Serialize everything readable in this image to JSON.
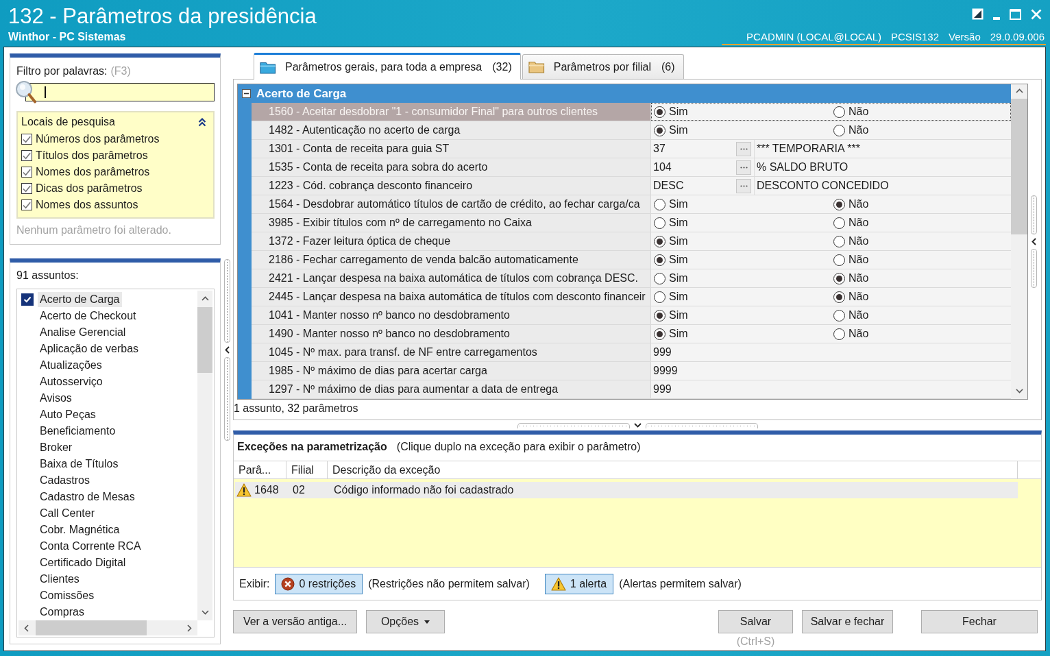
{
  "window": {
    "title": "132 - Parâmetros da presidência",
    "subtitle": "Winthor - PC Sistemas",
    "session": "PCADMIN (LOCAL@LOCAL)",
    "program": "PCSIS132",
    "version_label": "Versão",
    "version": "29.0.09.006"
  },
  "filter": {
    "label": "Filtro por palavras:",
    "shortcut": "(F3)"
  },
  "search_locations": {
    "title": "Locais de pesquisa",
    "expanded": true,
    "options": [
      {
        "label": "Números dos parâmetros",
        "checked": true
      },
      {
        "label": "Títulos dos parâmetros",
        "checked": true
      },
      {
        "label": "Nomes dos parâmetros",
        "checked": true
      },
      {
        "label": "Dicas dos parâmetros",
        "checked": true
      },
      {
        "label": "Nomes dos assuntos",
        "checked": true
      }
    ]
  },
  "change_status": "Nenhum parâmetro foi alterado.",
  "subjects": {
    "count_label": "91 assuntos:",
    "items": [
      {
        "label": "Acerto de Carga",
        "checked": true,
        "selected": true
      },
      {
        "label": "Acerto de Checkout",
        "checked": false,
        "selected": false
      },
      {
        "label": "Analise Gerencial",
        "checked": false,
        "selected": false
      },
      {
        "label": "Aplicação de verbas",
        "checked": false,
        "selected": false
      },
      {
        "label": "Atualizações",
        "checked": false,
        "selected": false
      },
      {
        "label": "Autosserviço",
        "checked": false,
        "selected": false
      },
      {
        "label": "Avisos",
        "checked": false,
        "selected": false
      },
      {
        "label": "Auto Peças",
        "checked": false,
        "selected": false
      },
      {
        "label": "Beneficiamento",
        "checked": false,
        "selected": false
      },
      {
        "label": "Broker",
        "checked": false,
        "selected": false
      },
      {
        "label": "Baixa de Títulos",
        "checked": false,
        "selected": false
      },
      {
        "label": "Cadastros",
        "checked": false,
        "selected": false
      },
      {
        "label": "Cadastro de Mesas",
        "checked": false,
        "selected": false
      },
      {
        "label": "Call Center",
        "checked": false,
        "selected": false
      },
      {
        "label": "Cobr. Magnética",
        "checked": false,
        "selected": false
      },
      {
        "label": "Conta Corrente RCA",
        "checked": false,
        "selected": false
      },
      {
        "label": "Certificado Digital",
        "checked": false,
        "selected": false
      },
      {
        "label": "Clientes",
        "checked": false,
        "selected": false
      },
      {
        "label": "Comissões",
        "checked": false,
        "selected": false
      },
      {
        "label": "Compras",
        "checked": false,
        "selected": false
      }
    ]
  },
  "tabs": [
    {
      "label": "Parâmetros gerais, para toda a empresa",
      "count": "(32)",
      "selected": true
    },
    {
      "label": "Parâmetros por filial",
      "count": "(6)",
      "selected": false
    }
  ],
  "parameters": {
    "group": {
      "title": "Acerto de Carga",
      "expanded": true
    },
    "rows": [
      {
        "name": "1560 - Aceitar desdobrar \"1 - consumidor Final\" para outros clientes",
        "selected": true,
        "kind": "radio",
        "options": [
          {
            "label": "Sim",
            "selected": true
          },
          {
            "label": "Não",
            "selected": false
          }
        ]
      },
      {
        "name": "1482 - Autenticação no acerto de carga",
        "selected": false,
        "kind": "radio",
        "options": [
          {
            "label": "Sim",
            "selected": true
          },
          {
            "label": "Não",
            "selected": false
          }
        ]
      },
      {
        "name": "1301 - Conta de receita para guia ST",
        "selected": false,
        "kind": "lookup",
        "code": "37",
        "description": "*** TEMPORARIA ***"
      },
      {
        "name": "1535 - Conta de receita para sobra do acerto",
        "selected": false,
        "kind": "lookup",
        "code": "104",
        "description": "% SALDO BRUTO"
      },
      {
        "name": "1223 - Cód. cobrança desconto financeiro",
        "selected": false,
        "kind": "lookup",
        "code": "DESC",
        "description": "DESCONTO CONCEDIDO"
      },
      {
        "name": "1564 - Desdobrar automático títulos de cartão de crédito, ao fechar carga/ca",
        "selected": false,
        "kind": "radio",
        "options": [
          {
            "label": "Sim",
            "selected": false
          },
          {
            "label": "Não",
            "selected": true
          }
        ]
      },
      {
        "name": "3985 - Exibir títulos com nº de carregamento no Caixa",
        "selected": false,
        "kind": "radio",
        "options": [
          {
            "label": "Sim",
            "selected": false
          },
          {
            "label": "Não",
            "selected": false
          }
        ]
      },
      {
        "name": "1372 - Fazer leitura óptica de cheque",
        "selected": false,
        "kind": "radio",
        "options": [
          {
            "label": "Sim",
            "selected": true
          },
          {
            "label": "Não",
            "selected": false
          }
        ]
      },
      {
        "name": "2186 - Fechar carregamento de venda balcão automaticamente",
        "selected": false,
        "kind": "radio",
        "options": [
          {
            "label": "Sim",
            "selected": true
          },
          {
            "label": "Não",
            "selected": false
          }
        ]
      },
      {
        "name": "2421 - Lançar despesa na baixa automática de títulos com cobrança DESC.",
        "selected": false,
        "kind": "radio",
        "options": [
          {
            "label": "Sim",
            "selected": false
          },
          {
            "label": "Não",
            "selected": true
          }
        ]
      },
      {
        "name": "2445 - Lançar despesa na baixa automática de títulos com desconto financeir",
        "selected": false,
        "kind": "radio",
        "options": [
          {
            "label": "Sim",
            "selected": false
          },
          {
            "label": "Não",
            "selected": true
          }
        ]
      },
      {
        "name": "1041 - Manter nosso nº banco no desdobramento",
        "selected": false,
        "kind": "radio",
        "options": [
          {
            "label": "Sim",
            "selected": true
          },
          {
            "label": "Não",
            "selected": false
          }
        ]
      },
      {
        "name": "1490 - Manter nosso nº banco no desdobramento",
        "selected": false,
        "kind": "radio",
        "options": [
          {
            "label": "Sim",
            "selected": true
          },
          {
            "label": "Não",
            "selected": false
          }
        ]
      },
      {
        "name": "1045 - Nº max. para transf. de NF entre carregamentos",
        "selected": false,
        "kind": "number",
        "value": "999"
      },
      {
        "name": "1985 - Nº máximo de dias para acertar carga",
        "selected": false,
        "kind": "number",
        "value": "9999"
      },
      {
        "name": "1297 - Nº máximo de dias para aumentar a data de entrega",
        "selected": false,
        "kind": "number",
        "value": "999"
      }
    ],
    "summary": "1 assunto, 32 parâmetros"
  },
  "exceptions": {
    "title": "Exceções na parametrização",
    "hint": "(Clique duplo na exceção para exibir o parâmetro)",
    "columns": [
      "Parâ...",
      "Filial",
      "Descrição da exceção"
    ],
    "rows": [
      {
        "kind": "alert",
        "selected": true,
        "cells": [
          "1648",
          "02",
          "Código informado não foi cadastrado"
        ]
      }
    ],
    "filters": {
      "label": "Exibir:",
      "items": [
        {
          "kind": "restriction",
          "label": "0 restrições",
          "note": "(Restrições não permitem salvar)",
          "on": true
        },
        {
          "kind": "alert",
          "label": "1 alerta",
          "note": "(Alertas permitem salvar)",
          "on": true
        }
      ]
    }
  },
  "footer": {
    "left_buttons": [
      {
        "label": "Ver a versão antiga...",
        "kind": "plain"
      },
      {
        "label": "Opções",
        "kind": "menu"
      }
    ],
    "right_buttons": [
      {
        "label": "Salvar",
        "hint": "(Ctrl+S)"
      },
      {
        "label": "Salvar e fechar"
      },
      {
        "label": "Fechar"
      }
    ]
  }
}
